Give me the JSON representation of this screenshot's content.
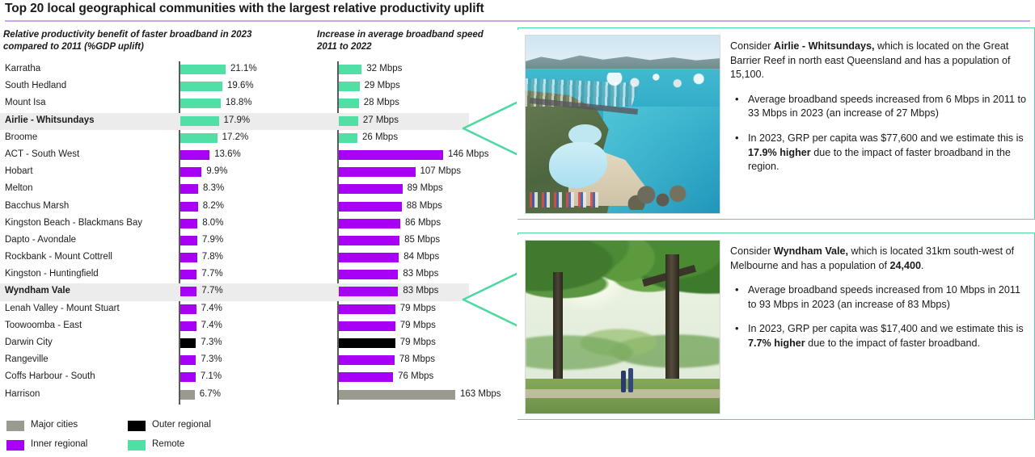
{
  "title": "Top 20 local geographical communities with the largest relative productivity uplift",
  "captions": {
    "col1": "Relative productivity benefit of faster broadband in 2023 compared to 2011 (%GDP uplift)",
    "col2": "Increase in average broadband speed 2011 to 2022"
  },
  "legend": {
    "items": [
      {
        "label": "Major cities",
        "color": "#9a9a8f"
      },
      {
        "label": "Outer regional",
        "color": "#000000"
      },
      {
        "label": "Inner regional",
        "color": "#a800f5"
      },
      {
        "label": "Remote",
        "color": "#50dfa5"
      }
    ]
  },
  "chart_data": {
    "type": "bar",
    "title": "Top 20 local geographical communities with the largest relative productivity uplift",
    "orientation": "horizontal",
    "categories": [
      "Karratha",
      "South Hedland",
      "Mount Isa",
      "Airlie - Whitsundays",
      "Broome",
      "ACT - South West",
      "Hobart",
      "Melton",
      "Bacchus Marsh",
      "Kingston Beach - Blackmans Bay",
      "Dapto - Avondale",
      "Rockbank - Mount Cottrell",
      "Kingston - Huntingfield",
      "Wyndham Vale",
      "Lenah Valley - Mount Stuart",
      "Toowoomba - East",
      "Darwin City",
      "Rangeville",
      "Coffs Harbour - South",
      "Harrison"
    ],
    "series": [
      {
        "name": "Relative productivity benefit of faster broadband in 2023 compared to 2011 (%GDP uplift)",
        "unit": "%",
        "xlabel": "",
        "xlim": [
          0,
          21.1
        ],
        "values": [
          21.1,
          19.6,
          18.8,
          17.9,
          17.2,
          13.6,
          9.9,
          8.3,
          8.2,
          8.0,
          7.9,
          7.8,
          7.7,
          7.7,
          7.4,
          7.4,
          7.3,
          7.3,
          7.1,
          6.7
        ],
        "labels": [
          "21.1%",
          "19.6%",
          "18.8%",
          "17.9%",
          "17.2%",
          "13.6%",
          "9.9%",
          "8.3%",
          "8.2%",
          "8.0%",
          "7.9%",
          "7.8%",
          "7.7%",
          "7.7%",
          "7.4%",
          "7.4%",
          "7.3%",
          "7.3%",
          "7.1%",
          "6.7%"
        ]
      },
      {
        "name": "Increase in average broadband speed 2011 to 2022",
        "unit": "Mbps",
        "xlabel": "",
        "xlim": [
          0,
          163
        ],
        "values": [
          32,
          29,
          28,
          27,
          26,
          146,
          107,
          89,
          88,
          86,
          85,
          84,
          83,
          83,
          79,
          79,
          79,
          78,
          76,
          163
        ],
        "labels": [
          "32 Mbps",
          "29 Mbps",
          "28 Mbps",
          "27 Mbps",
          "26 Mbps",
          "146 Mbps",
          "107 Mbps",
          "89 Mbps",
          "88 Mbps",
          "86 Mbps",
          "85 Mbps",
          "84 Mbps",
          "83 Mbps",
          "83 Mbps",
          "79 Mbps",
          "79 Mbps",
          "79 Mbps",
          "78 Mbps",
          "76 Mbps",
          "163 Mbps"
        ]
      }
    ],
    "group_by_category": [
      "Remote",
      "Remote",
      "Remote",
      "Remote",
      "Remote",
      "Inner regional",
      "Inner regional",
      "Inner regional",
      "Inner regional",
      "Inner regional",
      "Inner regional",
      "Inner regional",
      "Inner regional",
      "Inner regional",
      "Inner regional",
      "Inner regional",
      "Outer regional",
      "Inner regional",
      "Inner regional",
      "Major cities"
    ],
    "highlighted": [
      "Airlie - Whitsundays",
      "Wyndham Vale"
    ],
    "legend": [
      "Major cities",
      "Outer regional",
      "Inner regional",
      "Remote"
    ],
    "legend_position": "bottom-left",
    "grid": false
  },
  "callouts": [
    {
      "image_name": "airlie-whitsundays-aerial-photo",
      "intro_pre": "Consider ",
      "intro_bold": "Airlie - Whitsundays,",
      "intro_post": " which is located on the Great Barrier Reef in north east Queensland and has a population of 15,100.",
      "bullet1": "Average broadband speeds increased from 6 Mbps in 2011 to 33 Mbps in 2023 (an increase of 27 Mbps)",
      "bullet2_pre": "In 2023, GRP per capita was $77,600 and we estimate this is ",
      "bullet2_bold": "17.9% higher",
      "bullet2_post": " due to the impact of faster broadband in the region."
    },
    {
      "image_name": "wyndham-vale-park-photo",
      "intro_pre": "Consider ",
      "intro_bold": "Wyndham Vale,",
      "intro_post": " which is located 31km south-west of Melbourne and has a population of ",
      "intro_bold2": "24,400",
      "intro_post2": ".",
      "bullet1": "Average broadband speeds increased from 10 Mbps in 2011 to 93 Mbps in 2023 (an increase of 83 Mbps)",
      "bullet2_pre": "In 2023, GRP per capita was $17,400 and we estimate this is ",
      "bullet2_bold": "7.7% higher",
      "bullet2_post": " due to the impact of faster broadband."
    }
  ],
  "colors": {
    "accent_rule": "#c9a7e8",
    "callout_border": "#4ed9a0",
    "highlight_row": "#ececec",
    "remote": "#50dfa5",
    "inner_regional": "#a800f5",
    "outer_regional": "#000000",
    "major_cities": "#9a9a8f"
  }
}
